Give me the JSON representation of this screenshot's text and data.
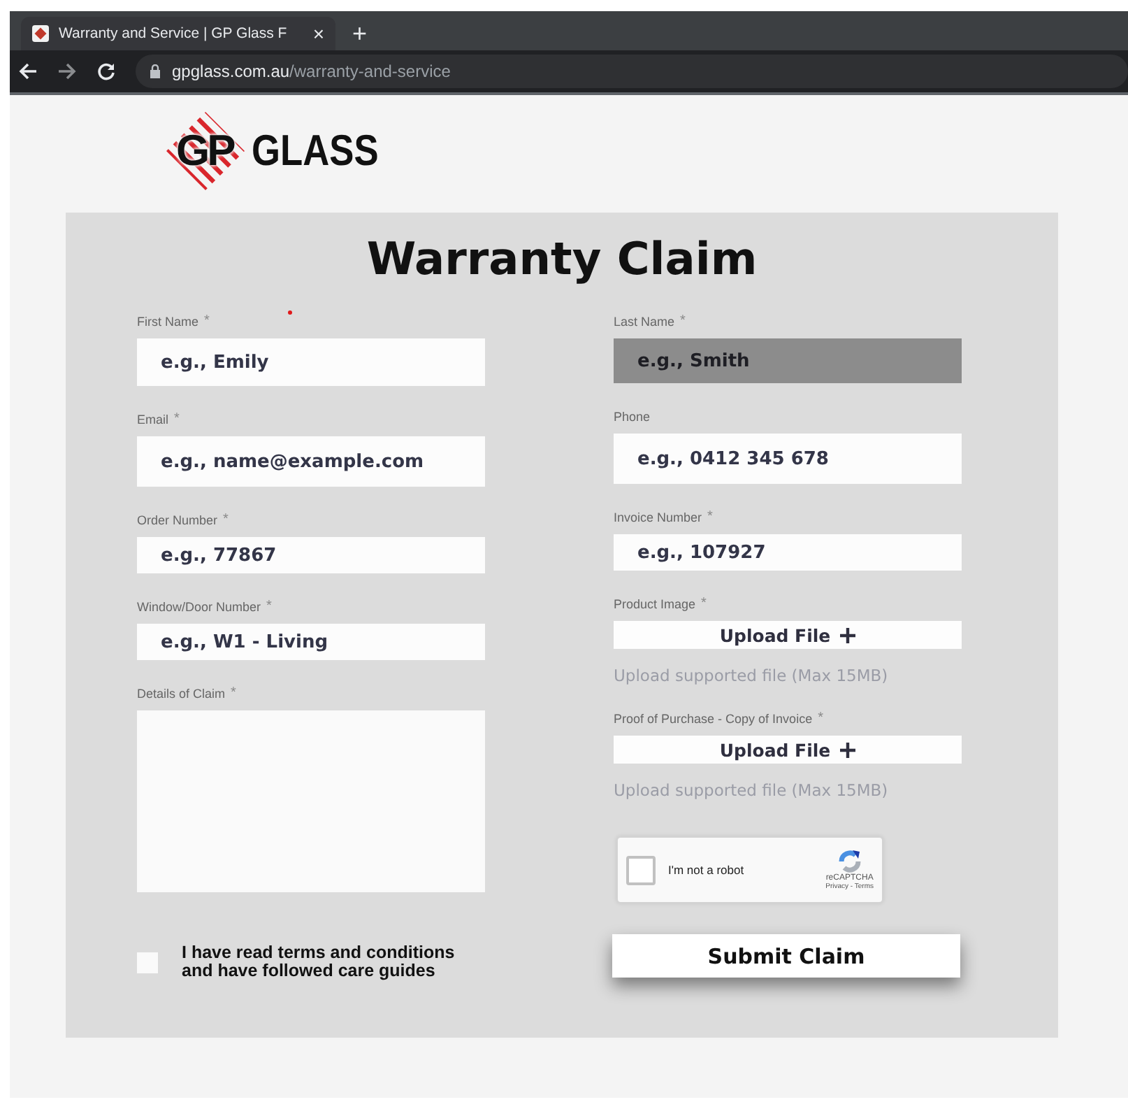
{
  "browser": {
    "tab": {
      "title": "Warranty and Service | GP Glass F",
      "close": "×"
    },
    "new_tab": "+",
    "url": {
      "host": "gpglass.com.au",
      "path": "/warranty-and-service"
    }
  },
  "logo": {
    "mark": "GP",
    "name": "GLASS"
  },
  "form": {
    "title": "Warranty Claim",
    "left": [
      {
        "kind": "text",
        "label": "First Name",
        "required_mark": "*",
        "placeholder": "e.g., Emily",
        "highlighted": false
      },
      {
        "kind": "text",
        "label": "Email",
        "required_mark": "*",
        "placeholder": "e.g., name@example.com",
        "highlighted": false
      },
      {
        "kind": "text",
        "label": "Order Number",
        "required_mark": "*",
        "placeholder": "e.g., 77867",
        "highlighted": false
      },
      {
        "kind": "text",
        "label": "Window/Door Number",
        "required_mark": "*",
        "placeholder": "e.g., W1 - Living",
        "highlighted": false
      },
      {
        "kind": "textarea",
        "label": "Details of Claim",
        "required_mark": "*"
      }
    ],
    "right": [
      {
        "kind": "text",
        "label": "Last Name",
        "required_mark": "*",
        "placeholder": "e.g., Smith",
        "highlighted": true
      },
      {
        "kind": "text",
        "label": "Phone",
        "placeholder": "e.g., 0412 345 678",
        "highlighted": false
      },
      {
        "kind": "text",
        "label": "Invoice Number",
        "required_mark": "*",
        "placeholder": "e.g., 107927",
        "highlighted": false
      },
      {
        "kind": "upload",
        "label": "Product Image",
        "required_mark": "*",
        "button": "Upload File",
        "hint": "Upload supported file (Max 15MB)"
      },
      {
        "kind": "upload",
        "label": "Proof of Purchase - Copy of Invoice",
        "required_mark": "*",
        "button": "Upload File",
        "hint": "Upload supported file (Max 15MB)"
      }
    ],
    "captcha": {
      "checked": false,
      "label": "I'm not a robot",
      "brand": "reCAPTCHA",
      "links": "Privacy - Terms"
    },
    "agreement": {
      "checked": false,
      "text": "I have read terms and conditions and have followed care guides"
    },
    "submit": "Submit Claim"
  }
}
